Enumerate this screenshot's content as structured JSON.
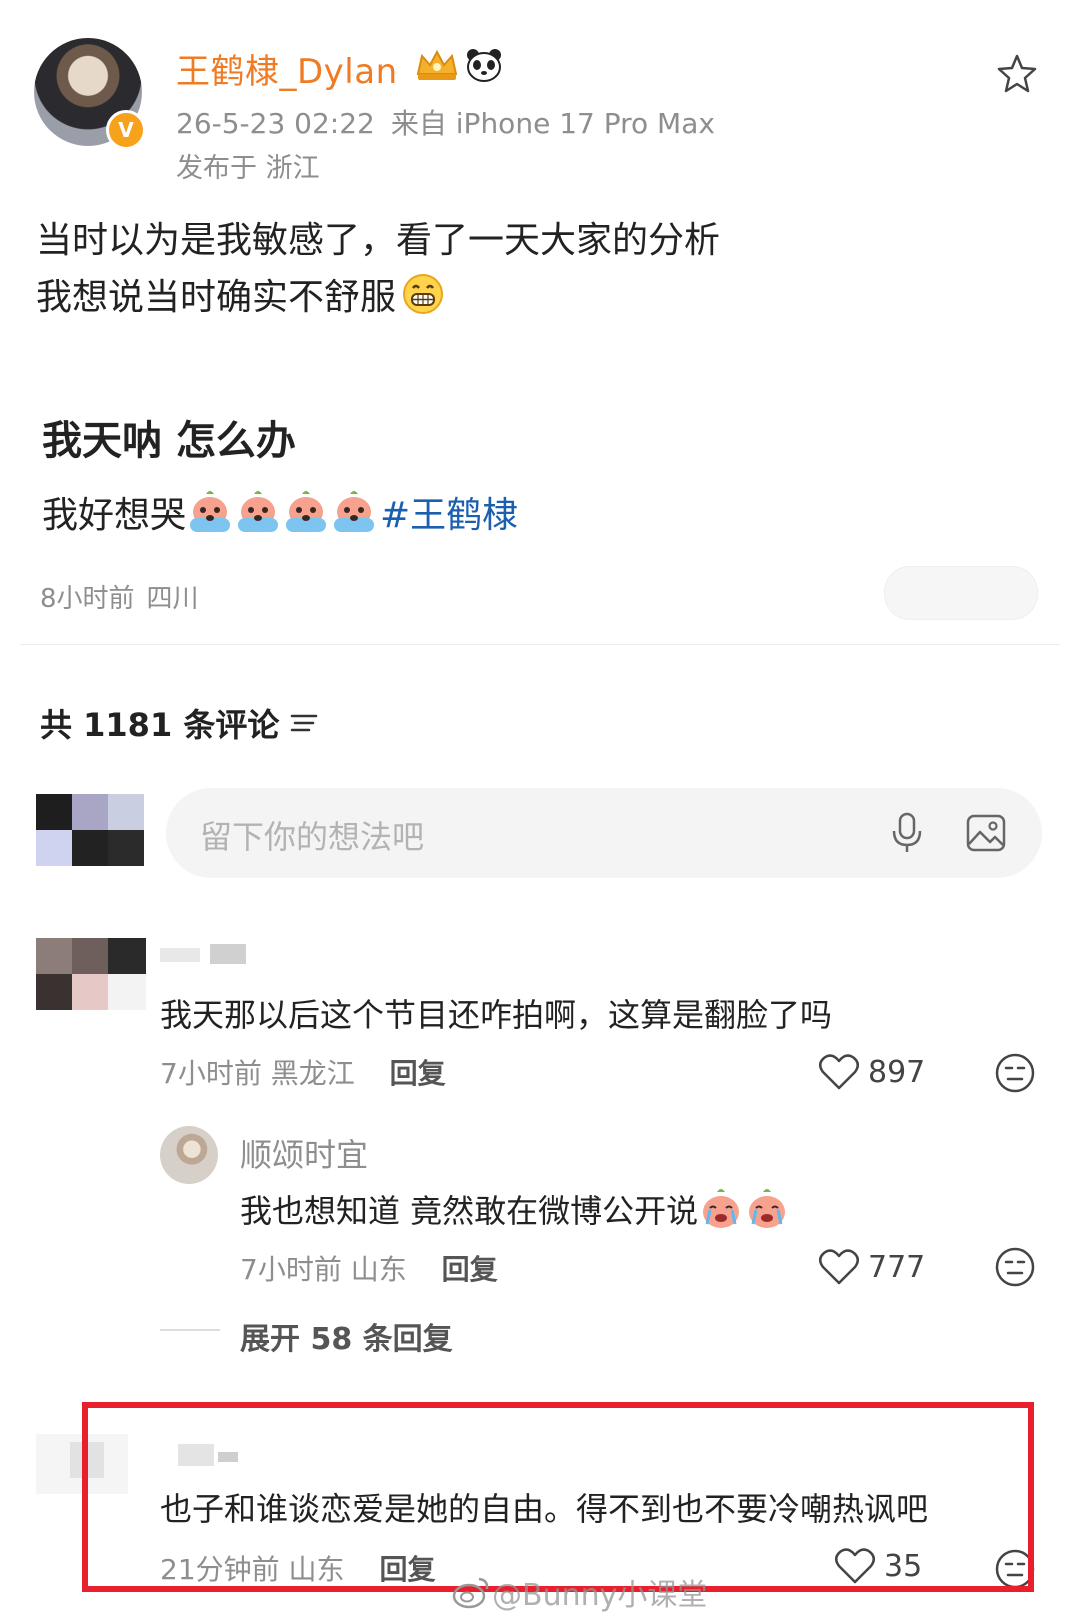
{
  "post": {
    "username": "王鹤棣_Dylan",
    "date": "26-5-23 02:22",
    "source": "来自 iPhone 17 Pro Max",
    "published_at": "发布于 浙江",
    "body_line1": "当时以为是我敏感了，看了一天大家的分析",
    "body_line2": "我想说当时确实不舒服"
  },
  "repost": {
    "title": "我天呐 怎么办",
    "text": "我好想哭",
    "hashtag": "#王鹤棣",
    "time": "8小时前",
    "location": "四川"
  },
  "comments_header": {
    "count_label": "共 1181 条评论"
  },
  "input": {
    "placeholder": "留下你的想法吧"
  },
  "comment1": {
    "text": "我天那以后这个节目还咋拍啊，这算是翻脸了吗",
    "time": "7小时前",
    "location": "黑龙江",
    "reply_label": "回复",
    "likes": "897"
  },
  "reply1": {
    "name": "顺颂时宜",
    "text": "我也想知道 竟然敢在微博公开说",
    "time": "7小时前",
    "location": "山东",
    "reply_label": "回复",
    "likes": "777"
  },
  "expand": {
    "label": "展开 58 条回复"
  },
  "comment2": {
    "text": "也子和谁谈恋爱是她的自由。得不到也不要冷嘲热讽吧",
    "time": "21分钟前",
    "location": "山东",
    "reply_label": "回复",
    "likes": "35"
  },
  "watermark": {
    "text": "@Bunny小课堂"
  },
  "colors": {
    "username": "#f07b25",
    "hashtag": "#1b5fae",
    "highlight": "#e8202e",
    "muted": "#8e8e8e"
  }
}
